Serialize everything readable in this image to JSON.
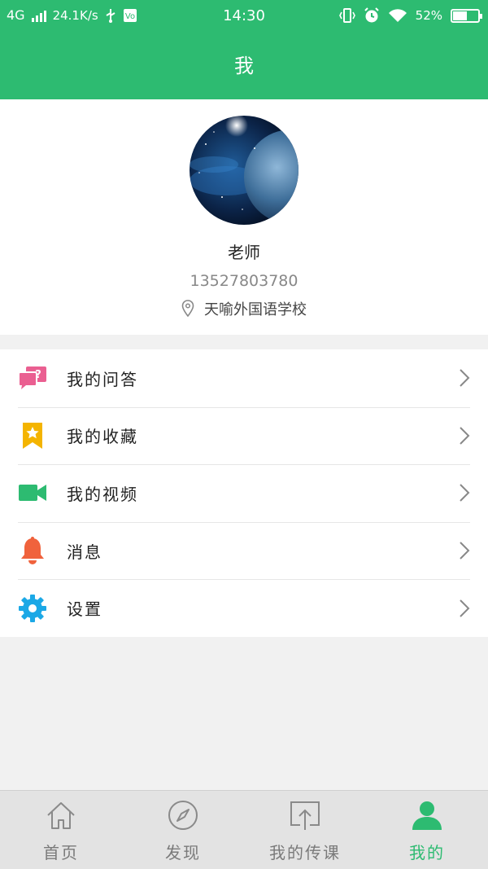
{
  "status_bar": {
    "network": "4G",
    "speed": "24.1K/s",
    "time": "14:30",
    "battery": "52%",
    "battery_level": 0.52
  },
  "header": {
    "title": "我"
  },
  "profile": {
    "name": "老师",
    "phone": "13527803780",
    "school": "天喻外国语学校"
  },
  "menu": {
    "items": [
      {
        "label": "我的问答",
        "icon": "qa-bubble-icon",
        "color": "#ea5f91"
      },
      {
        "label": "我的收藏",
        "icon": "bookmark-star-icon",
        "color": "#f4b400"
      },
      {
        "label": "我的视频",
        "icon": "video-camera-icon",
        "color": "#2dbb71"
      },
      {
        "label": "消息",
        "icon": "bell-icon",
        "color": "#f0623c"
      },
      {
        "label": "设置",
        "icon": "gear-icon",
        "color": "#1ba8e6"
      }
    ]
  },
  "tabbar": {
    "tabs": [
      {
        "label": "首页",
        "icon": "home-icon"
      },
      {
        "label": "发现",
        "icon": "compass-icon"
      },
      {
        "label": "我的传课",
        "icon": "upload-icon"
      },
      {
        "label": "我的",
        "icon": "person-icon",
        "active": true
      }
    ],
    "active_color": "#2dbb71"
  }
}
